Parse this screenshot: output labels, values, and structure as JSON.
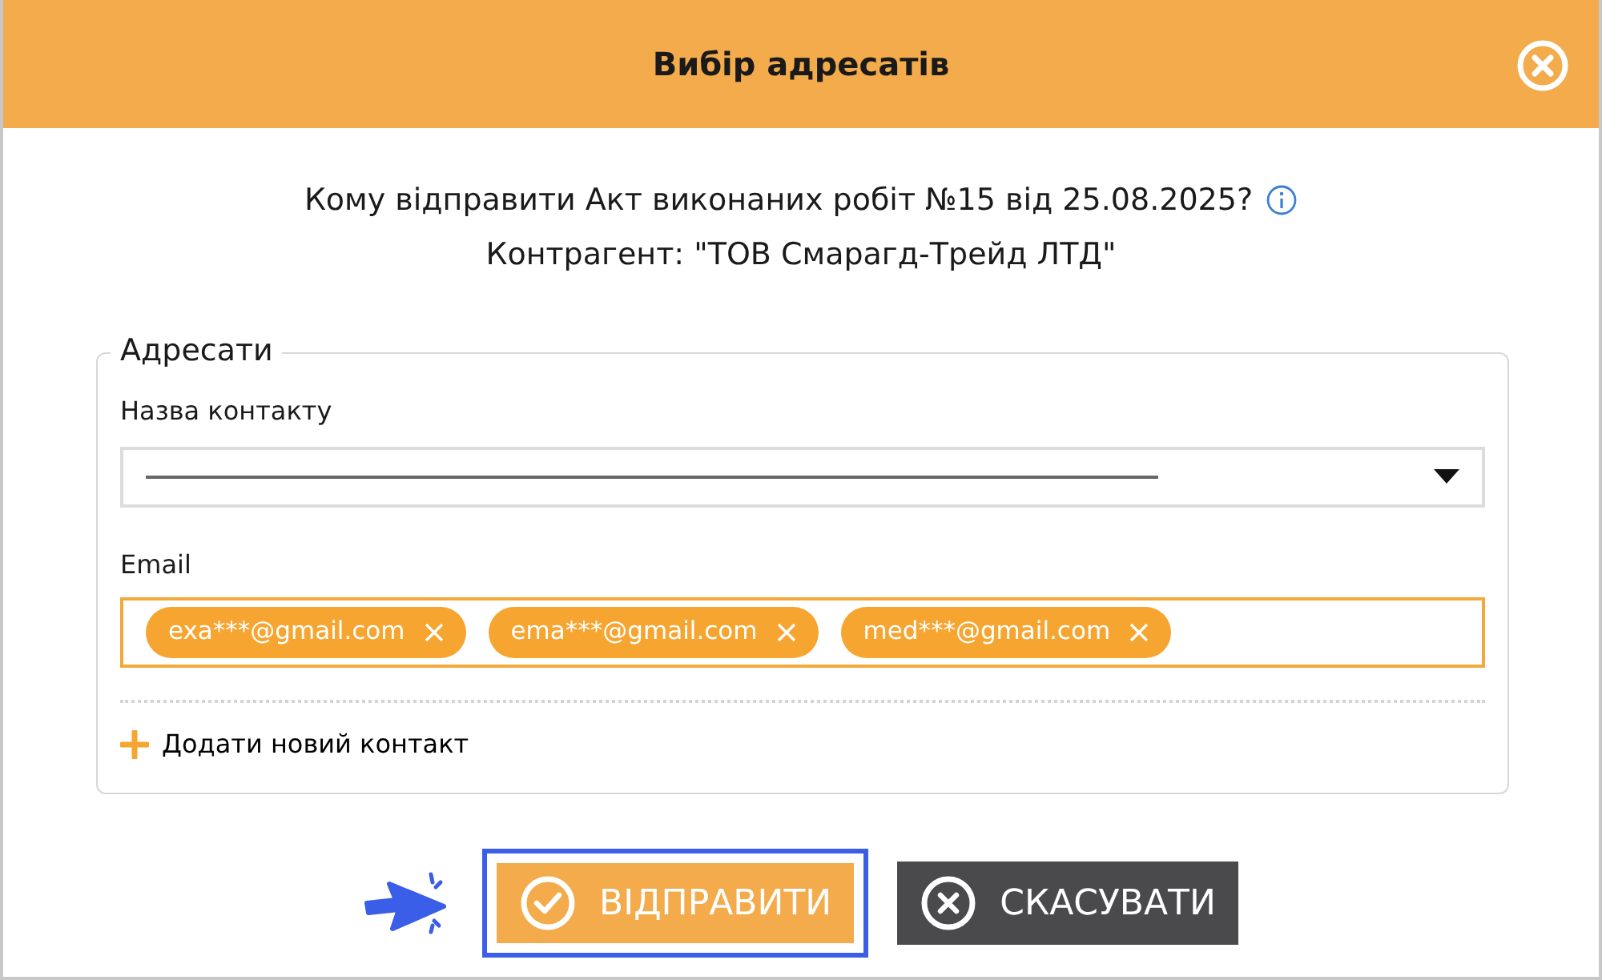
{
  "dialog": {
    "title": "Вибір адресатів"
  },
  "question": "Кому відправити Акт виконаних робіт №15 від 25.08.2025?",
  "counterparty": "Контрагент: \"ТОВ Смарагд-Трейд ЛТД\"",
  "recipients": {
    "legend": "Адресати",
    "contact_label": "Назва контакту",
    "email_label": "Email",
    "emails": [
      {
        "label": "exa***@gmail.com"
      },
      {
        "label": "ema***@gmail.com"
      },
      {
        "label": "med***@gmail.com"
      }
    ],
    "add_contact": "Додати новий контакт"
  },
  "buttons": [
    {
      "kind": "send",
      "label": "ВІДПРАВИТИ",
      "highlighted": true
    },
    {
      "kind": "cancel",
      "label": "СКАСУВАТИ",
      "highlighted": false
    }
  ]
}
